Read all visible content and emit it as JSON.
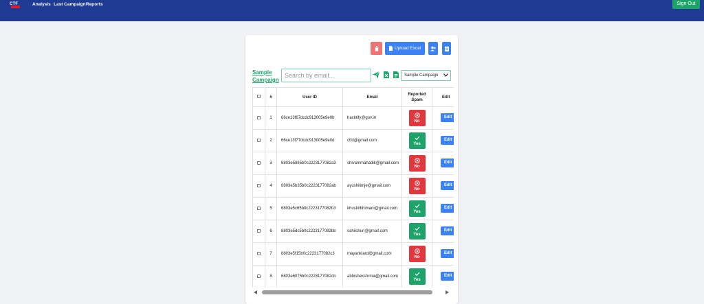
{
  "nav": {
    "logo_text": "CTF",
    "links": [
      "Analysis",
      "Last Campaign",
      "Reports"
    ],
    "signout_label": "Sign Out"
  },
  "toolbar": {
    "upload_label": "Upload Excel"
  },
  "filters": {
    "campaign_link": "Sample Campaign",
    "search_placeholder": "Search by email...",
    "campaign_select": "Sample Campaign"
  },
  "table": {
    "headers": {
      "num": "#",
      "user_id": "User ID",
      "email": "Email",
      "spam": "Reported Spam",
      "edit": "Edit"
    },
    "edit_label": "Edit",
    "rows": [
      {
        "num": "1",
        "user_id": "66ce13f67dcdc913005e9e0b",
        "email": "hacktify@gov.in",
        "spam": "No"
      },
      {
        "num": "2",
        "user_id": "66ce13f77dcdc913005e9e0d",
        "email": "ctfd@gmail.com",
        "spam": "Yes"
      },
      {
        "num": "3",
        "user_id": "6803e5885b0c2223177082a3",
        "email": "shivammahadik@gmail.com",
        "spam": "No"
      },
      {
        "num": "4",
        "user_id": "6803e5b35b0c2223177082ab",
        "email": "ayushilimje@gmail.com",
        "spam": "No"
      },
      {
        "num": "5",
        "user_id": "6803e5c65b0c2223177082b3",
        "email": "khushilbhimani@gmail.com",
        "spam": "Yes"
      },
      {
        "num": "6",
        "user_id": "6803e5dc5b0c2223177082bb",
        "email": "sahilchuri@gmail.com",
        "spam": "Yes"
      },
      {
        "num": "7",
        "user_id": "6803e5f15b0c2223177082c3",
        "email": "mayanklard@gmail.com",
        "spam": "No"
      },
      {
        "num": "8",
        "user_id": "6803e6075b0c2223177082cb",
        "email": "abhishekshrma@gmail.com",
        "spam": "Yes"
      }
    ]
  },
  "colors": {
    "nav_bg": "#1f3a93",
    "accent_green": "#1ea36a",
    "primary_blue": "#3b82f6",
    "danger_red": "#e0383e"
  }
}
